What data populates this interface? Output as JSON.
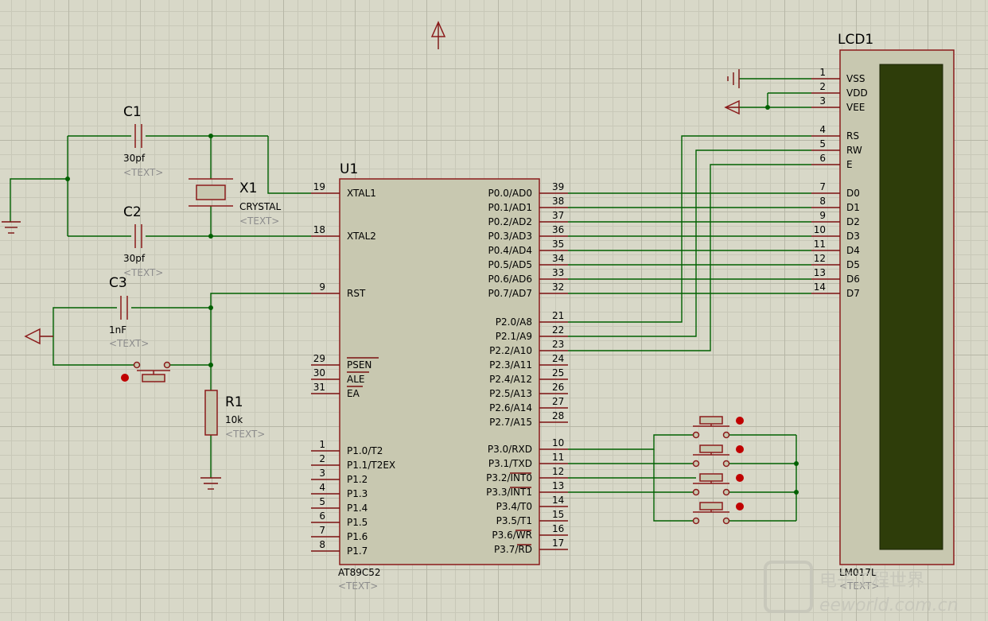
{
  "u1": {
    "ref": "U1",
    "part": "AT89C52",
    "text": "<TEXT>",
    "left_pins": [
      {
        "num": "19",
        "label": "XTAL1"
      },
      {
        "num": "18",
        "label": "XTAL2"
      },
      {
        "num": "9",
        "label": "RST"
      },
      {
        "num": "29",
        "label": "PSEN"
      },
      {
        "num": "30",
        "label": "ALE"
      },
      {
        "num": "31",
        "label": "EA"
      },
      {
        "num": "1",
        "label": "P1.0/T2"
      },
      {
        "num": "2",
        "label": "P1.1/T2EX"
      },
      {
        "num": "3",
        "label": "P1.2"
      },
      {
        "num": "4",
        "label": "P1.3"
      },
      {
        "num": "5",
        "label": "P1.4"
      },
      {
        "num": "6",
        "label": "P1.5"
      },
      {
        "num": "7",
        "label": "P1.6"
      },
      {
        "num": "8",
        "label": "P1.7"
      }
    ],
    "right_pins": [
      {
        "num": "39",
        "label": "P0.0/AD0"
      },
      {
        "num": "38",
        "label": "P0.1/AD1"
      },
      {
        "num": "37",
        "label": "P0.2/AD2"
      },
      {
        "num": "36",
        "label": "P0.3/AD3"
      },
      {
        "num": "35",
        "label": "P0.4/AD4"
      },
      {
        "num": "34",
        "label": "P0.5/AD5"
      },
      {
        "num": "33",
        "label": "P0.6/AD6"
      },
      {
        "num": "32",
        "label": "P0.7/AD7"
      },
      {
        "num": "21",
        "label": "P2.0/A8"
      },
      {
        "num": "22",
        "label": "P2.1/A9"
      },
      {
        "num": "23",
        "label": "P2.2/A10"
      },
      {
        "num": "24",
        "label": "P2.3/A11"
      },
      {
        "num": "25",
        "label": "P2.4/A12"
      },
      {
        "num": "26",
        "label": "P2.5/A13"
      },
      {
        "num": "27",
        "label": "P2.6/A14"
      },
      {
        "num": "28",
        "label": "P2.7/A15"
      },
      {
        "num": "10",
        "label": "P3.0/RXD"
      },
      {
        "num": "11",
        "label": "P3.1/TXD"
      },
      {
        "num": "12",
        "label": "P3.2/INT0"
      },
      {
        "num": "13",
        "label": "P3.3/INT1"
      },
      {
        "num": "14",
        "label": "P3.4/T0"
      },
      {
        "num": "15",
        "label": "P3.5/T1"
      },
      {
        "num": "16",
        "label": "P3.6/WR"
      },
      {
        "num": "17",
        "label": "P3.7/RD"
      }
    ]
  },
  "lcd": {
    "ref": "LCD1",
    "part": "LM017L",
    "text": "<TEXT>",
    "pins": [
      {
        "num": "1",
        "label": "VSS"
      },
      {
        "num": "2",
        "label": "VDD"
      },
      {
        "num": "3",
        "label": "VEE"
      },
      {
        "num": "4",
        "label": "RS"
      },
      {
        "num": "5",
        "label": "RW"
      },
      {
        "num": "6",
        "label": "E"
      },
      {
        "num": "7",
        "label": "D0"
      },
      {
        "num": "8",
        "label": "D1"
      },
      {
        "num": "9",
        "label": "D2"
      },
      {
        "num": "10",
        "label": "D3"
      },
      {
        "num": "11",
        "label": "D4"
      },
      {
        "num": "12",
        "label": "D5"
      },
      {
        "num": "13",
        "label": "D6"
      },
      {
        "num": "14",
        "label": "D7"
      }
    ]
  },
  "c1": {
    "ref": "C1",
    "value": "30pf",
    "text": "<TEXT>"
  },
  "c2": {
    "ref": "C2",
    "value": "30pf",
    "text": "<TEXT>"
  },
  "c3": {
    "ref": "C3",
    "value": "1nF",
    "text": "<TEXT>"
  },
  "x1": {
    "ref": "X1",
    "value": "CRYSTAL",
    "text": "<TEXT>"
  },
  "r1": {
    "ref": "R1",
    "value": "10k",
    "text": "<TEXT>"
  },
  "watermark": {
    "cn": "电子工程世界",
    "url": "eeworld.com.cn"
  },
  "colors": {
    "wire": "#006000",
    "component": "#8b1a1a",
    "body": "#c8c8b0",
    "lcd_screen": "#2e3d0a",
    "background": "#d8d8c8"
  }
}
